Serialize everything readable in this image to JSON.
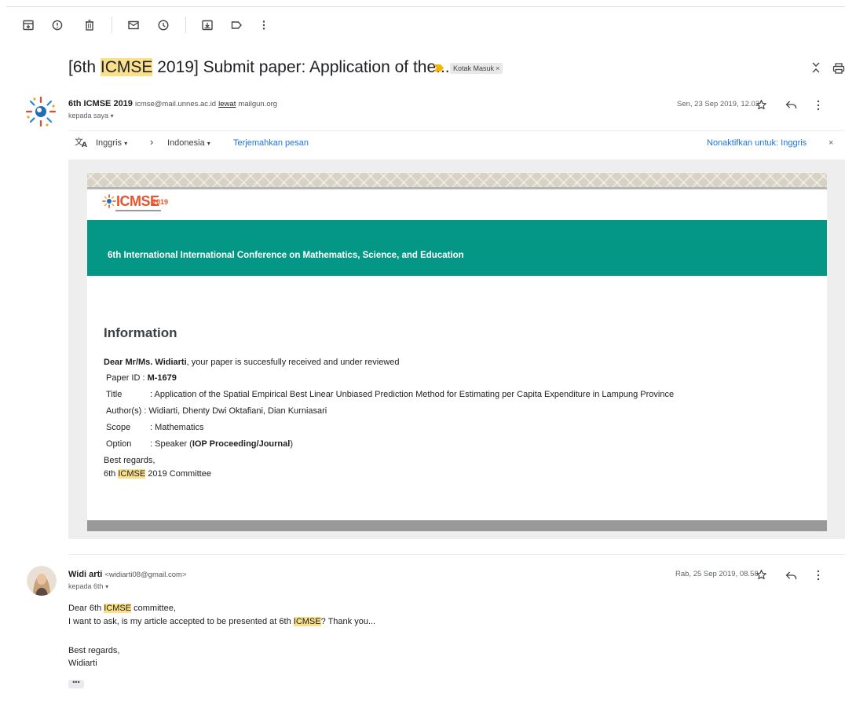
{
  "toolbar": {
    "icons": [
      "archive-icon",
      "report-spam-icon",
      "delete-icon",
      "mark-unread-icon",
      "snooze-icon",
      "move-to-icon",
      "label-icon",
      "more-vert-icon"
    ]
  },
  "thread": {
    "subject_pre": "[6th ",
    "subject_hl": "ICMSE",
    "subject_post": " 2019] Submit paper: Application of the...",
    "label_chip": "Kotak Masuk",
    "label_close": "×"
  },
  "message1": {
    "sender_name": "6th ICMSE 2019",
    "sender_email": "icmse@mail.unnes.ac.id",
    "via_word": "lewat",
    "via_domain": "mailgun.org",
    "recipient": "kepada saya",
    "date": "Sen, 23 Sep 2019, 12.02"
  },
  "translate": {
    "from_lang": "Inggris",
    "to_lang": "Indonesia",
    "translate_link": "Terjemahkan pesan",
    "disable_link": "Nonaktifkan untuk: Inggris",
    "close": "×"
  },
  "email_body": {
    "logo_text": "ICMSE",
    "logo_year": "2019",
    "banner": "6th International International Conference on Mathematics, Science, and Education",
    "heading": "Information",
    "greeting_bold": "Dear Mr/Ms. Widiarti",
    "greeting_rest": ", your paper is succesfully received and under reviewed",
    "paper_id_label": "Paper ID",
    "paper_id_value": "M-1679",
    "title_label": "Title",
    "title_value": ": Application of the Spatial Empirical Best Linear Unbiased Prediction Method for Estimating per Capita Expenditure in Lampung Province",
    "authors_label": "Author(s)",
    "authors_value": ": Widiarti, Dhenty Dwi Oktafiani, Dian Kurniasari",
    "scope_label": "Scope",
    "scope_value": ": Mathematics",
    "option_label": "Option",
    "option_value_pre": ": Speaker (",
    "option_value_bold": "IOP Proceeding/Journal",
    "option_value_post": ")",
    "closing": "Best regards,",
    "sign_pre": "6th ",
    "sign_hl": "ICMSE",
    "sign_post": " 2019 Committee"
  },
  "message2": {
    "sender_name": "Widi arti",
    "sender_email": "<widiarti08@gmail.com>",
    "recipient": "kepada 6th",
    "date": "Rab, 25 Sep 2019, 08.58",
    "line1_pre": "Dear 6th ",
    "line1_hl": "ICMSE",
    "line1_post": " committee,",
    "line2_pre": "I want to ask, is my article accepted to be presented at 6th ",
    "line2_hl": "ICMSE",
    "line2_post": "? Thank you...",
    "closing": "Best regards,",
    "signature": "Widiarti",
    "show_trimmed": "•••"
  }
}
